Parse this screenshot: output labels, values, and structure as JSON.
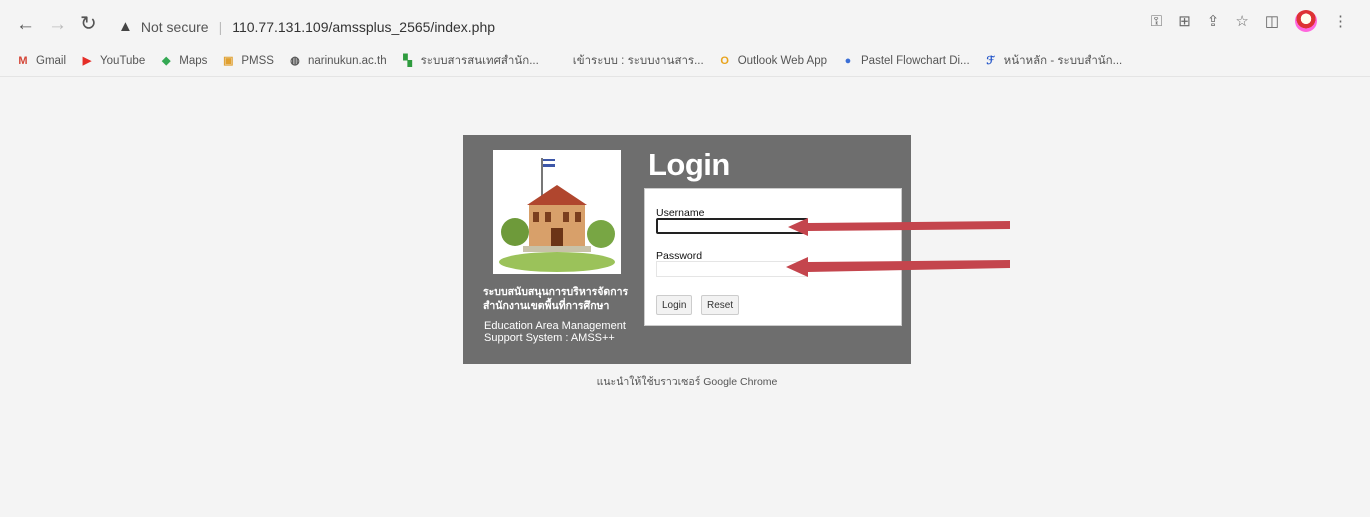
{
  "browser": {
    "security_label": "Not secure",
    "url": "110.77.131.109/amssplus_2565/index.php",
    "colors": {
      "arrow_annotation": "#c4454d",
      "panel_bg": "#6e6e6e"
    }
  },
  "bookmarks": [
    {
      "label": "Gmail",
      "icon": "gmail-icon",
      "glyph": "M",
      "color": "#d44638"
    },
    {
      "label": "YouTube",
      "icon": "youtube-icon",
      "glyph": "▶",
      "color": "#e52d27"
    },
    {
      "label": "Maps",
      "icon": "maps-icon",
      "glyph": "◆",
      "color": "#34a853"
    },
    {
      "label": "PMSS",
      "icon": "pmss-icon",
      "glyph": "▣",
      "color": "#e0a030"
    },
    {
      "label": "narinukun.ac.th",
      "icon": "globe-icon",
      "glyph": "◍",
      "color": "#555"
    },
    {
      "label": "ระบบสารสนเทศสำนัก...",
      "icon": "thai-site-icon",
      "glyph": "▚",
      "color": "#2e9b3e"
    },
    {
      "label": "เข้าระบบ : ระบบงานสาร...",
      "icon": "blank-icon",
      "glyph": "",
      "color": "#ffffff"
    },
    {
      "label": "Outlook Web App",
      "icon": "outlook-icon",
      "glyph": "O",
      "color": "#e8a31c"
    },
    {
      "label": "Pastel Flowchart Di...",
      "icon": "pastel-icon",
      "glyph": "●",
      "color": "#3b6fd6"
    },
    {
      "label": "หน้าหลัก - ระบบสำนัก...",
      "icon": "flag-icon",
      "glyph": "ℱ",
      "color": "#2456c9"
    }
  ],
  "login": {
    "heading": "Login",
    "thai_title": "ระบบสนับสนุนการบริหารจัดการ สำนักงานเขตพื้นที่การศึกษา",
    "english_title": "Education Area Management Support System : AMSS++",
    "username_label": "Username",
    "password_label": "Password",
    "login_button": "Login",
    "reset_button": "Reset"
  },
  "footer": {
    "note": "แนะนำให้ใช้บราวเซอร์ Google Chrome"
  }
}
